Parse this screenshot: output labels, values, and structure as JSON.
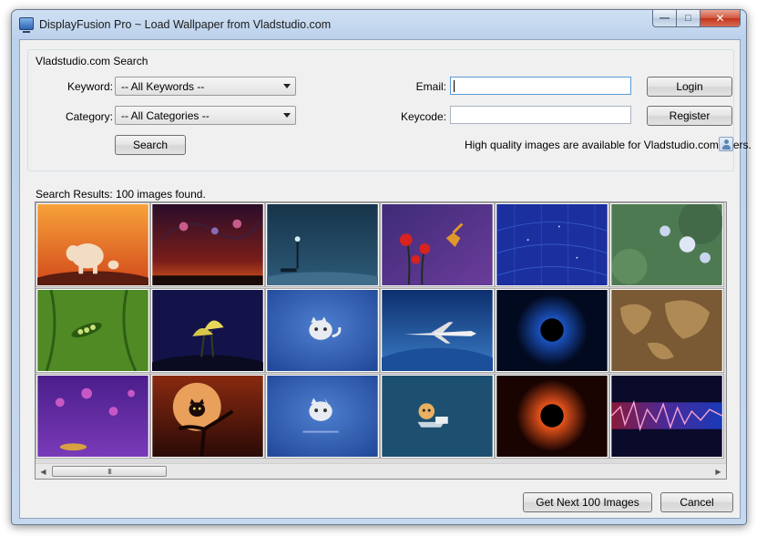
{
  "window": {
    "title": "DisplayFusion Pro ~ Load Wallpaper from Vladstudio.com"
  },
  "search": {
    "group_title": "Vladstudio.com Search",
    "keyword_label": "Keyword:",
    "keyword_value": "-- All Keywords --",
    "category_label": "Category:",
    "category_value": "-- All Categories --",
    "search_button": "Search",
    "email_label": "Email:",
    "email_value": "",
    "keycode_label": "Keycode:",
    "keycode_value": "",
    "login_button": "Login",
    "register_button": "Register",
    "hq_note": "High quality images are available for Vladstudio.com users."
  },
  "results": {
    "label": "Search Results: 100 images found.",
    "scroll_thumb": "III",
    "thumbnails": [
      {
        "icon": "elephant-sunset"
      },
      {
        "icon": "birds-night-sky"
      },
      {
        "icon": "foggy-park-lamp"
      },
      {
        "icon": "hummingbird-poppies"
      },
      {
        "icon": "blue-constellation-map"
      },
      {
        "icon": "blue-flowers"
      },
      {
        "icon": "pea-pod-vines"
      },
      {
        "icon": "glowing-mushrooms"
      },
      {
        "icon": "white-cat-blue"
      },
      {
        "icon": "airplane-over-earth"
      },
      {
        "icon": "solar-eclipse-blue"
      },
      {
        "icon": "vintage-world-map"
      },
      {
        "icon": "purple-floral"
      },
      {
        "icon": "cat-on-moon-tree"
      },
      {
        "icon": "white-cat-blue"
      },
      {
        "icon": "monkey-laptop"
      },
      {
        "icon": "solar-eclipse-orange"
      },
      {
        "icon": "sound-wave-spectrum"
      }
    ]
  },
  "footer": {
    "next_button": "Get Next 100 Images",
    "cancel_button": "Cancel"
  }
}
